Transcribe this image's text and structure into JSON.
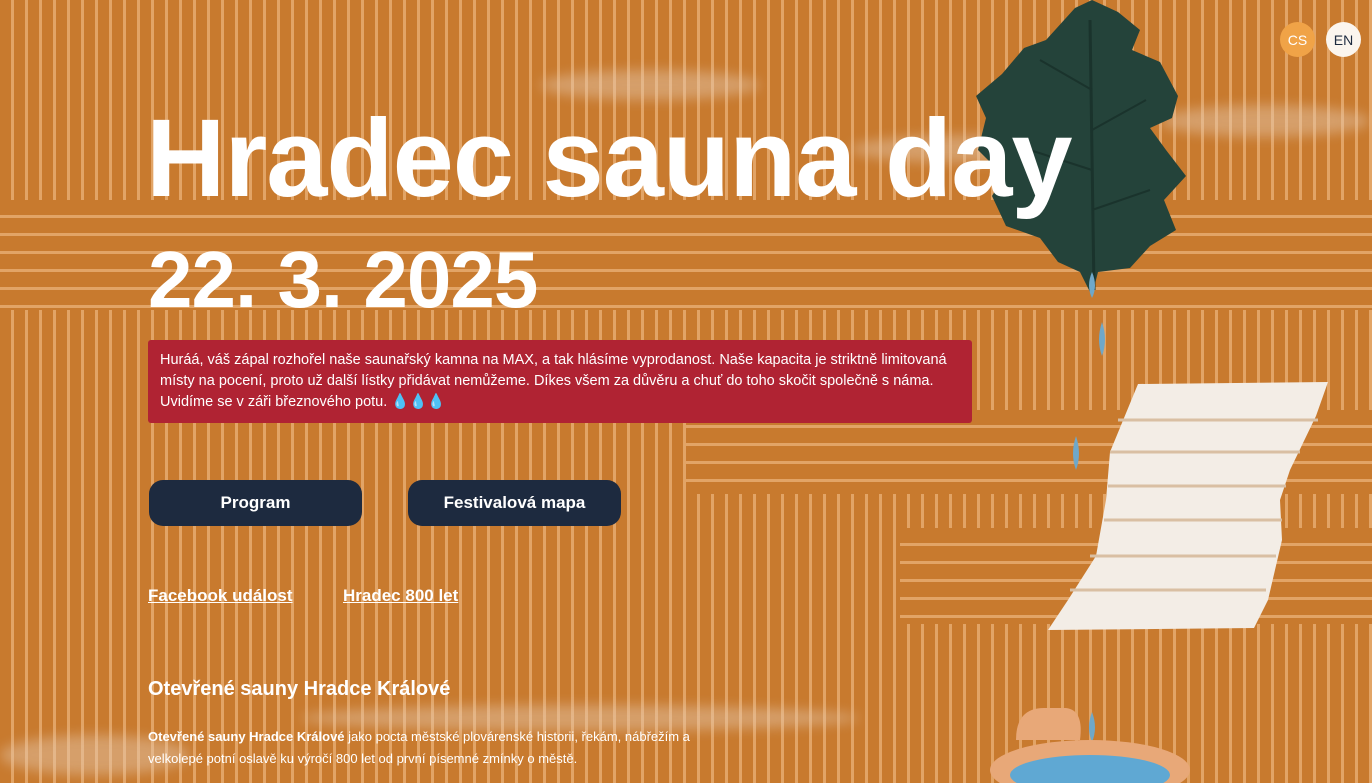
{
  "language": {
    "options": [
      "CS",
      "EN"
    ],
    "active": "CS"
  },
  "hero": {
    "title": "Hradec sauna day",
    "date": "22. 3. 2025"
  },
  "notice": {
    "text": "Huráá, váš zápal rozhořel naše saunařský kamna na MAX, a tak hlásíme vyprodanost. Naše kapacita je striktně limitovaná místy na pocení, proto už další lístky přidávat nemůžeme. Díkes všem za důvěru a chuť do toho skočit společně s náma. Uvidíme se v záři březnového potu. 💧💧💧",
    "color": "#b02333"
  },
  "buttons": {
    "program": "Program",
    "map": "Festivalová mapa"
  },
  "links": {
    "facebook": "Facebook událost",
    "hradec800": "Hradec 800 let"
  },
  "section": {
    "title": "Otevřené sauny Hradce Králové",
    "lead_bold": "Otevřené sauny Hradce Králové",
    "lead_rest": " jako pocta městské plovárenské historii, řekám, nábřežím a velkolepé potní oslavě ku výročí 800 let od první písemné zmínky o městě."
  },
  "icons": [
    "birch-whisk-icon",
    "water-drop-icon",
    "towel-icon",
    "sauna-bucket-icon"
  ],
  "colors": {
    "wood": "#c87a2e",
    "slat": "#e2a466",
    "button": "#1d2a3f",
    "lang_active": "#f0a347",
    "lang_inactive": "#fbf5ee"
  }
}
